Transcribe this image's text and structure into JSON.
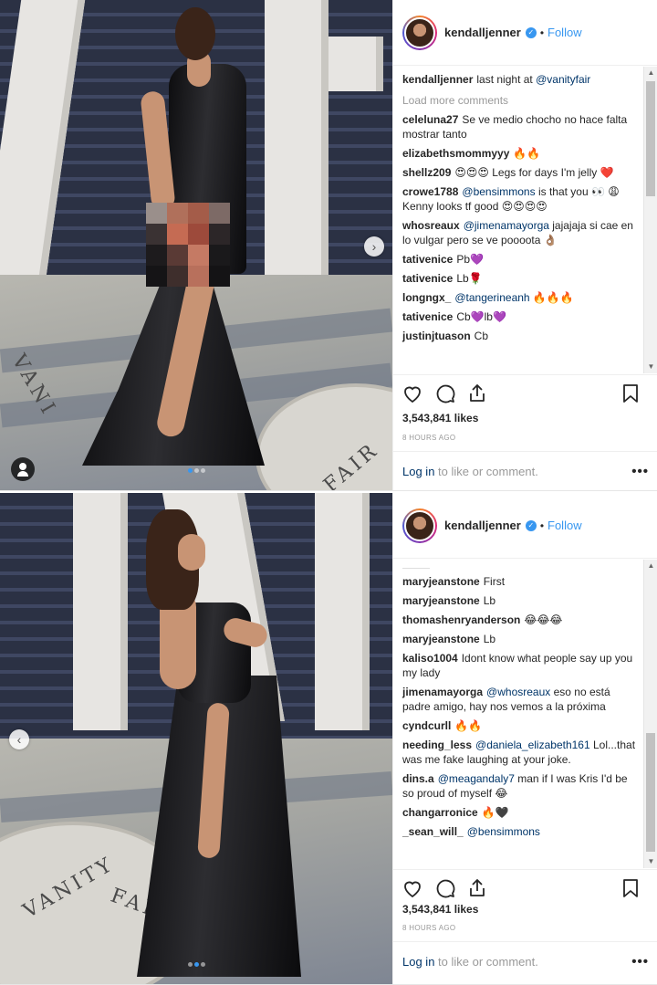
{
  "posts": [
    {
      "username": "kendalljenner",
      "follow": "Follow",
      "separator": "•",
      "caption": {
        "user": "kendalljenner",
        "pre": "last night at ",
        "mention": "@vanityfair"
      },
      "load_more": "Load more comments",
      "comments": [
        {
          "user": "celeluna27",
          "text": "Se ve medio chocho no hace falta mostrar tanto"
        },
        {
          "user": "elizabethsmommyyy",
          "text": "🔥🔥"
        },
        {
          "user": "shellz209",
          "text": "😍😍😍 Legs for days I'm jelly ❤️"
        },
        {
          "user": "crowe1788",
          "mention": "@bensimmons",
          "text": " is that you 👀 😩 Kenny looks tf good 😍😍😍😍"
        },
        {
          "user": "whosreaux",
          "mention": "@jimenamayorga",
          "text": " jajajaja si cae en lo vulgar pero se ve poooota 👌🏽"
        },
        {
          "user": "tativenice",
          "text": "Pb💜"
        },
        {
          "user": "tativenice",
          "text": "Lb🌹"
        },
        {
          "user": "longngx_",
          "mention": "@tangerineanh",
          "text": " 🔥🔥🔥"
        },
        {
          "user": "tativenice",
          "text": "Cb💜lb💜"
        },
        {
          "user": "justinjtuason",
          "text": "Cb"
        }
      ],
      "likes": "3,543,841 likes",
      "time": "8 HOURS AGO",
      "login_link": "Log in",
      "login_text": " to like or comment.",
      "more": "•••",
      "carousel": {
        "count": 3,
        "active": 1
      }
    },
    {
      "username": "kendalljenner",
      "follow": "Follow",
      "separator": "•",
      "comments": [
        {
          "user": "maryjeanstone",
          "text": "First"
        },
        {
          "user": "maryjeanstone",
          "text": "Lb"
        },
        {
          "user": "thomashenryanderson",
          "text": "😂😂😂"
        },
        {
          "user": "maryjeanstone",
          "text": "Lb"
        },
        {
          "user": "kaliso1004",
          "text": "Idont know what people say up you my lady"
        },
        {
          "user": "jimenamayorga",
          "mention": "@whosreaux",
          "text": " eso no está padre amigo, hay nos vemos a la próxima"
        },
        {
          "user": "cyndcurll",
          "text": "🔥🔥"
        },
        {
          "user": "needing_less",
          "mention": "@daniela_elizabeth161",
          "text": " Lol...that was me fake laughing at your joke."
        },
        {
          "user": "dins.a",
          "mention": "@meagandaly7",
          "text": " man if I was Kris I'd be so proud of myself 😂"
        },
        {
          "user": "changarronice",
          "text": "🔥🖤"
        },
        {
          "user": "_sean_will_",
          "mention": "@bensimmons",
          "text": ""
        }
      ],
      "likes": "3,543,841 likes",
      "time": "8 HOURS AGO",
      "login_link": "Log in",
      "login_text": " to like or comment.",
      "more": "•••",
      "carousel": {
        "count": 3,
        "active": 2
      }
    }
  ],
  "icons": {
    "like": "heart-icon",
    "comment": "comment-icon",
    "share": "share-icon",
    "save": "bookmark-icon",
    "next": "chevron-right-icon",
    "prev": "chevron-left-icon",
    "verified": "verified-badge-icon"
  },
  "colors": {
    "link": "#3897f0",
    "mention": "#003569",
    "muted": "#999999"
  }
}
